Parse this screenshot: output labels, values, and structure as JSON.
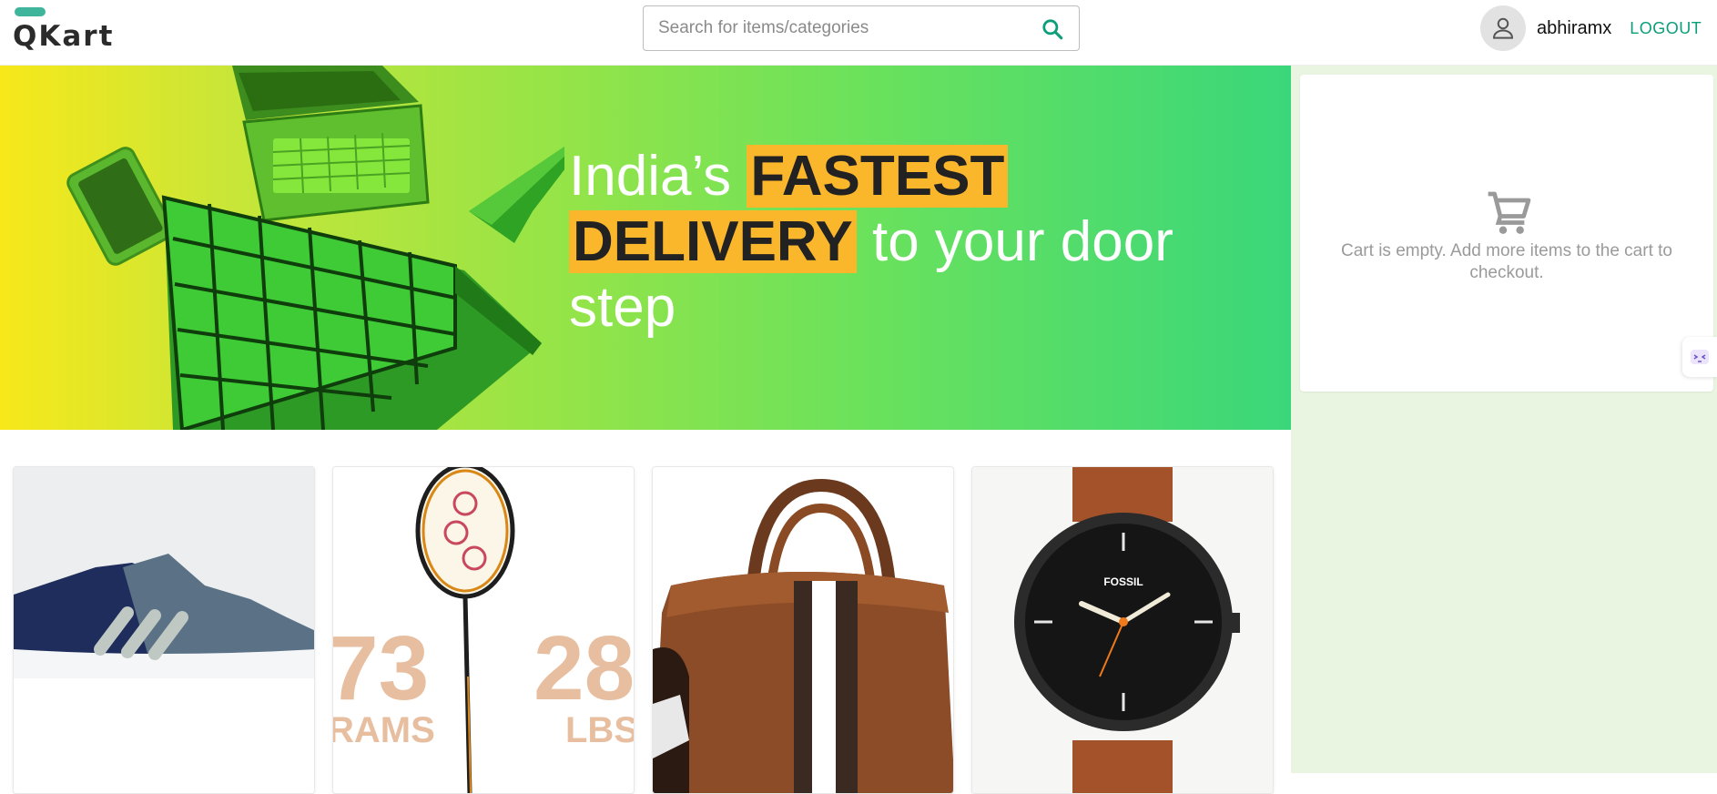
{
  "header": {
    "logo_text": "QKart",
    "search": {
      "placeholder": "Search for items/categories",
      "value": ""
    },
    "username": "abhiramx",
    "logout_label": "LOGOUT"
  },
  "hero": {
    "line_1_plain": "India’s ",
    "line_1_highlight": "FASTEST",
    "line_2_highlight": "DELIVERY",
    "line_2_plain": " to your door",
    "line_3_plain": "step"
  },
  "products": [
    {
      "name": "sneaker-image"
    },
    {
      "name": "badminton-racket-image",
      "text_left_1": "73",
      "text_left_2": "RAMS",
      "text_right_1": "28",
      "text_right_2": "LBS"
    },
    {
      "name": "duffel-bag-image"
    },
    {
      "name": "wrist-watch-image",
      "brand": "FOSSIL"
    }
  ],
  "cart": {
    "empty_message": "Cart is empty. Add more items to the cart to checkout."
  },
  "colors": {
    "accent": "#0b9e7a",
    "logo_bar": "#3fb59b",
    "highlight": "#fbb72c",
    "cart_bg": "#e9f5e1"
  },
  "icons": [
    "search-icon",
    "user-icon",
    "cart-icon",
    "side-widget-icon"
  ]
}
